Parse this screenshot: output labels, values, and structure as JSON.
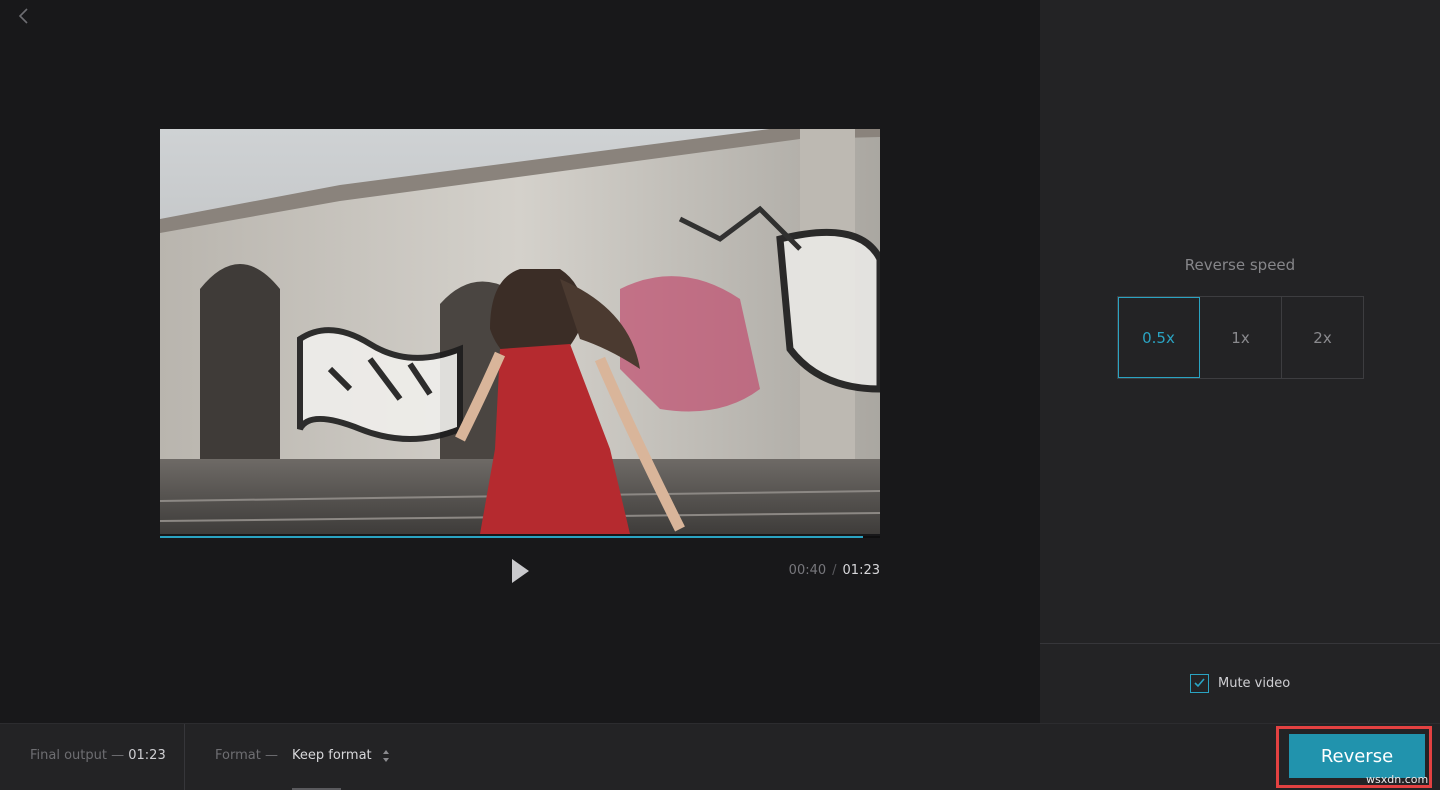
{
  "player": {
    "current_time": "00:40",
    "separator": "/",
    "total_time": "01:23",
    "progress_fraction": 0.976
  },
  "settings": {
    "speed_label": "Reverse speed",
    "speed_options": [
      "0.5x",
      "1x",
      "2x"
    ],
    "selected_speed": "0.5x",
    "mute_label": "Mute video",
    "mute_checked": true
  },
  "footer": {
    "final_output_label": "Final output —",
    "final_output_value": "01:23",
    "format_label": "Format —",
    "format_value": "Keep format",
    "reverse_button": "Reverse",
    "watermark": "wsxdn.com"
  },
  "icons": {
    "back": "chevron-left-icon",
    "play": "play-icon",
    "check": "check-icon",
    "sort": "up-down-arrows-icon"
  },
  "colors": {
    "accent": "#2aa3c2",
    "button": "#2193ad",
    "highlight": "#e34141"
  }
}
